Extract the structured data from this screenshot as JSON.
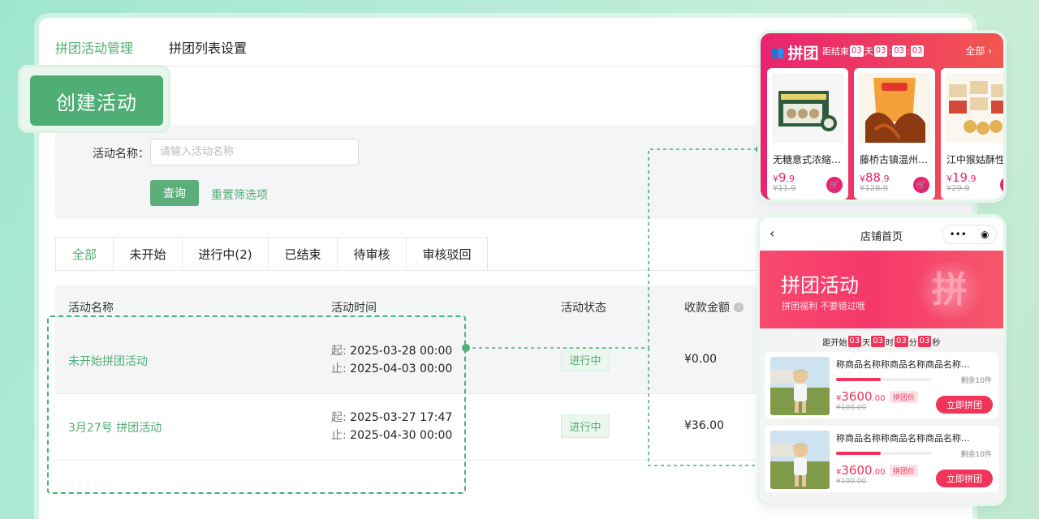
{
  "nav": {
    "tabs": [
      {
        "label": "拼团活动管理",
        "active": true
      },
      {
        "label": "拼团列表设置",
        "active": false
      }
    ]
  },
  "create_button": "创建活动",
  "filter": {
    "name_label": "活动名称：",
    "name_placeholder": "请输入活动名称",
    "query_button": "查询",
    "reset_link": "重置筛选项"
  },
  "status_tabs": [
    "全部",
    "未开始",
    "进行中(2)",
    "已结束",
    "待审核",
    "审核驳回"
  ],
  "table": {
    "headers": {
      "name": "活动名称",
      "time": "活动时间",
      "status": "活动状态",
      "amount": "收款金额"
    },
    "start_label": "起:",
    "end_label": "止:",
    "rows": [
      {
        "name": "未开始拼团活动",
        "start": "2025-03-28 00:00",
        "end": "2025-04-03 00:00",
        "status": "进行中",
        "amount": "¥0.00"
      },
      {
        "name": "3月27号 拼团活动",
        "start": "2025-03-27 17:47",
        "end": "2025-04-30 00:00",
        "status": "进行中",
        "amount": "¥36.00"
      }
    ]
  },
  "preview_a": {
    "logo": "拼团",
    "countdown_label": "距结束",
    "countdown": [
      "03",
      "天",
      "03",
      ":",
      "03",
      ":",
      "03"
    ],
    "all_link": "全部 ›",
    "products": [
      {
        "title": "无糖意式浓缩…",
        "currency": "¥",
        "price_int": "9",
        "price_dec": ".9",
        "old": "¥11.9"
      },
      {
        "title": "藤桥古镇温州…",
        "currency": "¥",
        "price_int": "88",
        "price_dec": ".9",
        "old": "¥128.9"
      },
      {
        "title": "江中猴姑酥性…",
        "currency": "¥",
        "price_int": "19",
        "price_dec": ".9",
        "old": "¥29.9"
      }
    ]
  },
  "preview_b": {
    "title": "店铺首页",
    "banner_title": "拼团活动",
    "banner_sub": "拼团福利 不要错过哦",
    "banner_glyph": "拼",
    "countdown": {
      "label": "距开始",
      "days": "03",
      "day_unit": "天",
      "hours": "03",
      "hour_unit": "时",
      "minutes": "03",
      "minute_unit": "分",
      "seconds": "03",
      "second_unit": "秒"
    },
    "items": [
      {
        "name": "称商品名称称商品名称商品名称...",
        "remain": "剩余10件",
        "currency": "¥",
        "price_int": "3600",
        "price_dec": ".00",
        "tag": "拼团价",
        "old": "¥100.00",
        "button": "立即拼团",
        "progress": 0.47
      },
      {
        "name": "称商品名称称商品名称商品名称...",
        "remain": "剩余10件",
        "currency": "¥",
        "price_int": "3600",
        "price_dec": ".00",
        "tag": "拼团价",
        "old": "¥100.00",
        "button": "立即拼团",
        "progress": 0.47
      }
    ]
  },
  "colors": {
    "accent": "#4fae73",
    "brand_pink": "#e8246f",
    "sale_red": "#f0345a"
  }
}
